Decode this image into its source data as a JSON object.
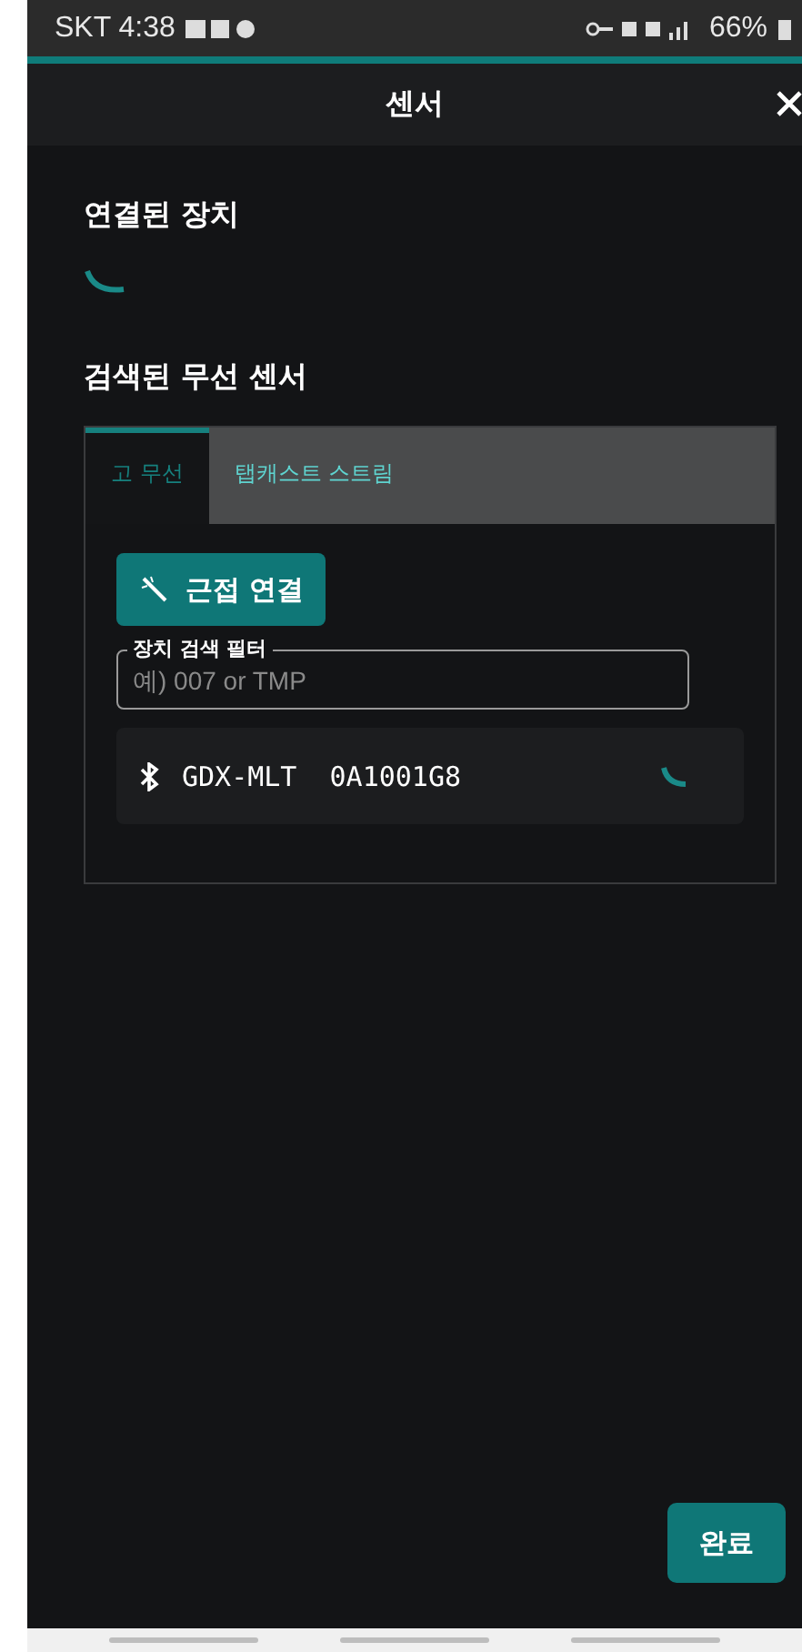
{
  "status_bar": {
    "time": "SKT 4:38",
    "battery": "66%"
  },
  "header": {
    "title": "센서"
  },
  "connected": {
    "heading": "연결된 장치",
    "loading": true
  },
  "found": {
    "heading": "검색된 무선 센서"
  },
  "tabs": [
    {
      "label": "고 무선",
      "selected": true
    },
    {
      "label": "탭캐스트 스트림",
      "selected": false
    }
  ],
  "proximity_button": "근접 연결",
  "filter": {
    "label": "장치 검색 필터",
    "placeholder": "예) 007 or TMP"
  },
  "devices": [
    {
      "name": "GDX-MLT  0A1001G8",
      "connecting": true
    }
  ],
  "done_button": "완료"
}
